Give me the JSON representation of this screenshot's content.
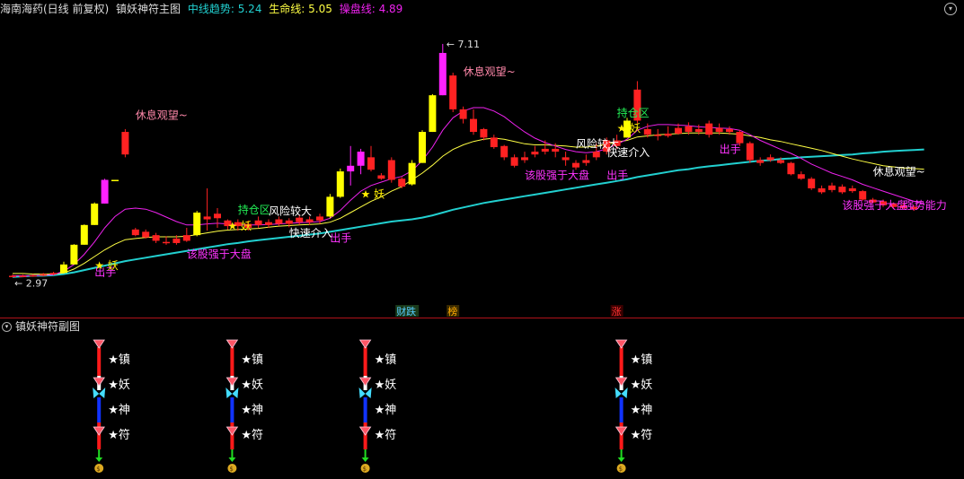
{
  "header": {
    "stock": "海南海药(日线 前复权)",
    "indicator": "镇妖神符主图",
    "mid_trend_label": "中线趋势:",
    "mid_trend_value": "5.24",
    "life_line_label": "生命线:",
    "life_line_value": "5.05",
    "operate_line_label": "操盘线:",
    "operate_line_value": "4.89"
  },
  "colors": {
    "up": "#ff2222",
    "down": "#ff2222",
    "strong_yellow": "#ffff00",
    "strong_magenta": "#ff22ff",
    "mid_trend": "#22d0d0",
    "life_line": "#ffff44",
    "operate_line": "#ee22ee",
    "bg": "#000000",
    "divider": "#b0121a"
  },
  "chart_data": {
    "type": "candlestick",
    "price_max_label": "7.11",
    "price_min_label": "2.97",
    "candles": [
      {
        "o": 2.98,
        "c": 3.0,
        "h": 3.02,
        "l": 2.97,
        "k": "r"
      },
      {
        "o": 3.0,
        "c": 3.0,
        "h": 3.02,
        "l": 2.98,
        "k": "r"
      },
      {
        "o": 2.99,
        "c": 3.01,
        "h": 3.03,
        "l": 2.98,
        "k": "r"
      },
      {
        "o": 3.0,
        "c": 3.03,
        "h": 3.05,
        "l": 2.99,
        "k": "r"
      },
      {
        "o": 3.03,
        "c": 3.05,
        "h": 3.07,
        "l": 3.01,
        "k": "r"
      },
      {
        "o": 3.05,
        "c": 3.2,
        "h": 3.25,
        "l": 3.04,
        "k": "y"
      },
      {
        "o": 3.2,
        "c": 3.55,
        "h": 3.56,
        "l": 3.2,
        "k": "y"
      },
      {
        "o": 3.55,
        "c": 3.9,
        "h": 3.91,
        "l": 3.55,
        "k": "y"
      },
      {
        "o": 3.9,
        "c": 4.28,
        "h": 4.3,
        "l": 3.9,
        "k": "y"
      },
      {
        "o": 4.28,
        "c": 4.7,
        "h": 4.72,
        "l": 4.28,
        "k": "m"
      },
      {
        "o": 4.7,
        "c": 4.7,
        "h": 4.7,
        "l": 4.7,
        "k": "y"
      },
      {
        "o": 5.15,
        "c": 5.55,
        "h": 5.6,
        "l": 5.1,
        "k": "r"
      },
      {
        "o": 3.82,
        "c": 3.72,
        "h": 3.85,
        "l": 3.7,
        "k": "r"
      },
      {
        "o": 3.68,
        "c": 3.78,
        "h": 3.82,
        "l": 3.66,
        "k": "r"
      },
      {
        "o": 3.72,
        "c": 3.62,
        "h": 3.76,
        "l": 3.58,
        "k": "r"
      },
      {
        "o": 3.6,
        "c": 3.6,
        "h": 3.7,
        "l": 3.55,
        "k": "r"
      },
      {
        "o": 3.58,
        "c": 3.66,
        "h": 3.72,
        "l": 3.55,
        "k": "r"
      },
      {
        "o": 3.62,
        "c": 3.72,
        "h": 3.85,
        "l": 3.6,
        "k": "r"
      },
      {
        "o": 3.72,
        "c": 4.12,
        "h": 4.15,
        "l": 3.7,
        "k": "y"
      },
      {
        "o": 4.0,
        "c": 4.05,
        "h": 4.55,
        "l": 3.8,
        "k": "r"
      },
      {
        "o": 4.1,
        "c": 4.02,
        "h": 4.2,
        "l": 3.85,
        "k": "r"
      },
      {
        "o": 3.98,
        "c": 3.88,
        "h": 4.0,
        "l": 3.82,
        "k": "r"
      },
      {
        "o": 3.88,
        "c": 3.95,
        "h": 4.0,
        "l": 3.8,
        "k": "r"
      },
      {
        "o": 3.92,
        "c": 3.85,
        "h": 3.98,
        "l": 3.8,
        "k": "r"
      },
      {
        "o": 3.9,
        "c": 3.98,
        "h": 4.05,
        "l": 3.85,
        "k": "r"
      },
      {
        "o": 3.95,
        "c": 3.9,
        "h": 4.0,
        "l": 3.85,
        "k": "r"
      },
      {
        "o": 3.92,
        "c": 4.0,
        "h": 4.05,
        "l": 3.88,
        "k": "r"
      },
      {
        "o": 3.98,
        "c": 3.92,
        "h": 4.02,
        "l": 3.86,
        "k": "r"
      },
      {
        "o": 3.95,
        "c": 4.03,
        "h": 4.08,
        "l": 3.9,
        "k": "r"
      },
      {
        "o": 4.0,
        "c": 3.95,
        "h": 4.05,
        "l": 3.9,
        "k": "r"
      },
      {
        "o": 3.98,
        "c": 4.05,
        "h": 4.1,
        "l": 3.92,
        "k": "r"
      },
      {
        "o": 4.05,
        "c": 4.4,
        "h": 4.45,
        "l": 4.02,
        "k": "y"
      },
      {
        "o": 4.4,
        "c": 4.85,
        "h": 4.9,
        "l": 4.38,
        "k": "y"
      },
      {
        "o": 4.85,
        "c": 4.95,
        "h": 5.3,
        "l": 4.6,
        "k": "m"
      },
      {
        "o": 4.95,
        "c": 5.2,
        "h": 5.25,
        "l": 4.8,
        "k": "m"
      },
      {
        "o": 5.1,
        "c": 4.88,
        "h": 5.3,
        "l": 4.85,
        "k": "r"
      },
      {
        "o": 4.78,
        "c": 4.72,
        "h": 4.82,
        "l": 4.7,
        "k": "r"
      },
      {
        "o": 5.05,
        "c": 4.7,
        "h": 5.1,
        "l": 4.65,
        "k": "r"
      },
      {
        "o": 4.72,
        "c": 4.58,
        "h": 4.75,
        "l": 4.55,
        "k": "r"
      },
      {
        "o": 4.62,
        "c": 5.0,
        "h": 5.05,
        "l": 4.6,
        "k": "y"
      },
      {
        "o": 5.0,
        "c": 5.55,
        "h": 5.58,
        "l": 5.0,
        "k": "y"
      },
      {
        "o": 5.55,
        "c": 6.2,
        "h": 6.22,
        "l": 5.55,
        "k": "y"
      },
      {
        "o": 6.2,
        "c": 6.95,
        "h": 7.11,
        "l": 6.2,
        "k": "m"
      },
      {
        "o": 6.55,
        "c": 5.95,
        "h": 6.6,
        "l": 5.9,
        "k": "r"
      },
      {
        "o": 5.95,
        "c": 5.78,
        "h": 6.0,
        "l": 5.7,
        "k": "r"
      },
      {
        "o": 5.78,
        "c": 5.55,
        "h": 5.95,
        "l": 5.5,
        "k": "r"
      },
      {
        "o": 5.6,
        "c": 5.45,
        "h": 5.62,
        "l": 5.4,
        "k": "r"
      },
      {
        "o": 5.45,
        "c": 5.28,
        "h": 5.5,
        "l": 5.25,
        "k": "r"
      },
      {
        "o": 5.3,
        "c": 5.1,
        "h": 5.32,
        "l": 5.05,
        "k": "r"
      },
      {
        "o": 5.1,
        "c": 4.95,
        "h": 5.15,
        "l": 4.92,
        "k": "r"
      },
      {
        "o": 5.05,
        "c": 5.1,
        "h": 5.2,
        "l": 5.0,
        "k": "r"
      },
      {
        "o": 5.15,
        "c": 5.2,
        "h": 5.3,
        "l": 5.1,
        "k": "r"
      },
      {
        "o": 5.25,
        "c": 5.2,
        "h": 5.4,
        "l": 5.15,
        "k": "r"
      },
      {
        "o": 5.2,
        "c": 5.25,
        "h": 5.35,
        "l": 5.1,
        "k": "r"
      },
      {
        "o": 5.1,
        "c": 5.05,
        "h": 5.2,
        "l": 4.95,
        "k": "r"
      },
      {
        "o": 5.0,
        "c": 4.92,
        "h": 5.05,
        "l": 4.88,
        "k": "r"
      },
      {
        "o": 5.0,
        "c": 5.05,
        "h": 5.15,
        "l": 4.95,
        "k": "r"
      },
      {
        "o": 5.1,
        "c": 5.2,
        "h": 5.35,
        "l": 5.05,
        "k": "r"
      },
      {
        "o": 5.2,
        "c": 5.4,
        "h": 5.45,
        "l": 5.15,
        "k": "r"
      },
      {
        "o": 5.4,
        "c": 5.3,
        "h": 5.5,
        "l": 5.25,
        "k": "r"
      },
      {
        "o": 5.45,
        "c": 5.75,
        "h": 5.8,
        "l": 5.45,
        "k": "y"
      },
      {
        "o": 6.3,
        "c": 5.75,
        "h": 6.45,
        "l": 5.7,
        "k": "r"
      },
      {
        "o": 5.6,
        "c": 5.5,
        "h": 5.7,
        "l": 5.45,
        "k": "r"
      },
      {
        "o": 5.5,
        "c": 5.48,
        "h": 5.6,
        "l": 5.4,
        "k": "r"
      },
      {
        "o": 5.48,
        "c": 5.52,
        "h": 5.65,
        "l": 5.45,
        "k": "r"
      },
      {
        "o": 5.52,
        "c": 5.62,
        "h": 5.7,
        "l": 5.5,
        "k": "r"
      },
      {
        "o": 5.65,
        "c": 5.55,
        "h": 5.72,
        "l": 5.5,
        "k": "r"
      },
      {
        "o": 5.55,
        "c": 5.6,
        "h": 5.68,
        "l": 5.5,
        "k": "r"
      },
      {
        "o": 5.7,
        "c": 5.5,
        "h": 5.75,
        "l": 5.45,
        "k": "r"
      },
      {
        "o": 5.55,
        "c": 5.62,
        "h": 5.7,
        "l": 5.5,
        "k": "r"
      },
      {
        "o": 5.6,
        "c": 5.55,
        "h": 5.65,
        "l": 5.5,
        "k": "r"
      },
      {
        "o": 5.55,
        "c": 5.35,
        "h": 5.58,
        "l": 5.3,
        "k": "r"
      },
      {
        "o": 5.35,
        "c": 5.05,
        "h": 5.38,
        "l": 5.0,
        "k": "r"
      },
      {
        "o": 5.05,
        "c": 5.0,
        "h": 5.1,
        "l": 4.95,
        "k": "r"
      },
      {
        "o": 5.1,
        "c": 5.05,
        "h": 5.15,
        "l": 5.02,
        "k": "r"
      },
      {
        "o": 5.05,
        "c": 5.0,
        "h": 5.1,
        "l": 4.98,
        "k": "r"
      },
      {
        "o": 5.0,
        "c": 4.8,
        "h": 5.02,
        "l": 4.78,
        "k": "r"
      },
      {
        "o": 4.8,
        "c": 4.72,
        "h": 4.85,
        "l": 4.7,
        "k": "r"
      },
      {
        "o": 4.72,
        "c": 4.55,
        "h": 4.75,
        "l": 4.52,
        "k": "r"
      },
      {
        "o": 4.55,
        "c": 4.48,
        "h": 4.6,
        "l": 4.45,
        "k": "r"
      },
      {
        "o": 4.6,
        "c": 4.52,
        "h": 4.65,
        "l": 4.48,
        "k": "r"
      },
      {
        "o": 4.58,
        "c": 4.48,
        "h": 4.62,
        "l": 4.45,
        "k": "r"
      },
      {
        "o": 4.55,
        "c": 4.5,
        "h": 4.6,
        "l": 4.47,
        "k": "r"
      },
      {
        "o": 4.5,
        "c": 4.35,
        "h": 4.52,
        "l": 4.33,
        "k": "r"
      },
      {
        "o": 4.35,
        "c": 4.3,
        "h": 4.38,
        "l": 4.28,
        "k": "r"
      },
      {
        "o": 4.32,
        "c": 4.25,
        "h": 4.35,
        "l": 4.22,
        "k": "r"
      },
      {
        "o": 4.28,
        "c": 4.22,
        "h": 4.3,
        "l": 4.2,
        "k": "r"
      },
      {
        "o": 4.25,
        "c": 4.2,
        "h": 4.3,
        "l": 4.18,
        "k": "r"
      },
      {
        "o": 4.22,
        "c": 4.18,
        "h": 4.25,
        "l": 4.15,
        "k": "r"
      }
    ],
    "mid_trend": [
      2.98,
      2.99,
      3.0,
      3.0,
      3.01,
      3.03,
      3.06,
      3.1,
      3.14,
      3.18,
      3.22,
      3.26,
      3.29,
      3.32,
      3.35,
      3.38,
      3.41,
      3.44,
      3.47,
      3.5,
      3.53,
      3.56,
      3.58,
      3.61,
      3.63,
      3.65,
      3.67,
      3.69,
      3.71,
      3.73,
      3.75,
      3.78,
      3.81,
      3.84,
      3.87,
      3.9,
      3.93,
      3.96,
      3.98,
      4.0,
      4.03,
      4.07,
      4.12,
      4.17,
      4.21,
      4.25,
      4.29,
      4.32,
      4.35,
      4.38,
      4.41,
      4.44,
      4.47,
      4.5,
      4.53,
      4.56,
      4.59,
      4.62,
      4.65,
      4.68,
      4.71,
      4.75,
      4.78,
      4.81,
      4.84,
      4.87,
      4.89,
      4.92,
      4.94,
      4.96,
      4.98,
      5.0,
      5.02,
      5.04,
      5.05,
      5.07,
      5.08,
      5.1,
      5.11,
      5.12,
      5.13,
      5.14,
      5.15,
      5.17,
      5.18,
      5.2,
      5.21,
      5.22,
      5.23,
      5.24
    ],
    "life_line": [
      3.04,
      3.04,
      3.03,
      3.03,
      3.03,
      3.05,
      3.12,
      3.22,
      3.34,
      3.46,
      3.56,
      3.64,
      3.66,
      3.68,
      3.69,
      3.69,
      3.69,
      3.7,
      3.73,
      3.76,
      3.79,
      3.81,
      3.82,
      3.83,
      3.84,
      3.86,
      3.88,
      3.89,
      3.9,
      3.91,
      3.92,
      3.95,
      4.02,
      4.12,
      4.22,
      4.32,
      4.4,
      4.5,
      4.58,
      4.7,
      4.82,
      4.96,
      5.12,
      5.24,
      5.32,
      5.38,
      5.42,
      5.44,
      5.42,
      5.38,
      5.34,
      5.32,
      5.32,
      5.31,
      5.3,
      5.28,
      5.28,
      5.3,
      5.33,
      5.37,
      5.4,
      5.46,
      5.48,
      5.5,
      5.51,
      5.52,
      5.53,
      5.53,
      5.53,
      5.53,
      5.52,
      5.51,
      5.48,
      5.45,
      5.41,
      5.38,
      5.34,
      5.3,
      5.26,
      5.22,
      5.17,
      5.12,
      5.07,
      5.03,
      4.99,
      4.95,
      4.93,
      4.91,
      4.9,
      4.89
    ],
    "operate_line": [
      3.0,
      3.0,
      3.0,
      3.01,
      3.02,
      3.08,
      3.2,
      3.38,
      3.6,
      3.85,
      4.05,
      4.18,
      4.2,
      4.18,
      4.12,
      4.04,
      3.96,
      3.9,
      3.9,
      3.92,
      3.93,
      3.92,
      3.9,
      3.9,
      3.9,
      3.91,
      3.92,
      3.93,
      3.94,
      3.95,
      3.96,
      4.02,
      4.16,
      4.34,
      4.5,
      4.6,
      4.66,
      4.72,
      4.76,
      4.86,
      5.04,
      5.28,
      5.58,
      5.8,
      5.92,
      5.98,
      5.98,
      5.92,
      5.82,
      5.68,
      5.55,
      5.44,
      5.36,
      5.3,
      5.24,
      5.2,
      5.18,
      5.2,
      5.25,
      5.33,
      5.42,
      5.58,
      5.65,
      5.68,
      5.68,
      5.67,
      5.66,
      5.64,
      5.63,
      5.62,
      5.61,
      5.58,
      5.5,
      5.4,
      5.32,
      5.24,
      5.17,
      5.08,
      4.98,
      4.9,
      4.82,
      4.76,
      4.7,
      4.62,
      4.56,
      4.5,
      4.44,
      4.38,
      4.32,
      4.28
    ]
  },
  "annotations": [
    {
      "text": "休息观望~",
      "i": 12,
      "p": 5.78,
      "color": "#ff88aa"
    },
    {
      "text": "休息观望~",
      "i": 44,
      "p": 6.55,
      "color": "#ff88aa"
    },
    {
      "text": "休息观望~",
      "i": 84,
      "p": 4.78,
      "color": "#ffffff"
    },
    {
      "text": "风险较大",
      "i": 25,
      "p": 4.08,
      "color": "#ffffff"
    },
    {
      "text": "持仓区",
      "i": 22,
      "p": 4.1,
      "color": "#22ee55"
    },
    {
      "text": "风险较大",
      "i": 55,
      "p": 5.27,
      "color": "#ffffff"
    },
    {
      "text": "持仓区",
      "i": 59,
      "p": 5.82,
      "color": "#22ee55"
    },
    {
      "text": "快速介入",
      "i": 27,
      "p": 3.69,
      "color": "#ffffff"
    },
    {
      "text": "快速介入",
      "i": 58,
      "p": 5.12,
      "color": "#ffffff"
    },
    {
      "text": "出手",
      "i": 31,
      "p": 3.6,
      "color": "#ff33ff"
    },
    {
      "text": "出手",
      "i": 58,
      "p": 4.72,
      "color": "#ff33ff"
    },
    {
      "text": "出手",
      "i": 69,
      "p": 5.18,
      "color": "#ff33ff"
    },
    {
      "text": "出手",
      "i": 8,
      "p": 3.0,
      "color": "#ff33ff"
    },
    {
      "text": "该股强于大盘",
      "i": 17,
      "p": 3.32,
      "color": "#ff33ff"
    },
    {
      "text": "该股强于大盘",
      "i": 50,
      "p": 4.72,
      "color": "#ff33ff"
    },
    {
      "text": "该股强于大盘",
      "i": 81,
      "p": 4.18,
      "color": "#ff33ff"
    },
    {
      "text": "强势能力",
      "i": 87,
      "p": 4.18,
      "color": "#ff33ff"
    },
    {
      "text": "★ 妖",
      "i": 8,
      "p": 3.12,
      "color": "#ffee00"
    },
    {
      "text": "★ 妖",
      "i": 21,
      "p": 3.82,
      "color": "#ffee00"
    },
    {
      "text": "★ 妖",
      "i": 34,
      "p": 4.38,
      "color": "#ffee00"
    },
    {
      "text": "★ 妖",
      "i": 59,
      "p": 5.55,
      "color": "#ffee00"
    }
  ],
  "event_badges": [
    {
      "text": "财跌",
      "i": 38,
      "color": "#55ccff",
      "bg": "#1a3a1a"
    },
    {
      "text": "榜",
      "i": 43,
      "color": "#ffaa00",
      "bg": "#3a2a00"
    },
    {
      "text": "涨",
      "i": 59,
      "color": "#ff3333",
      "bg": "#3a0000"
    }
  ],
  "sub": {
    "title": "镇妖神符副图",
    "signal_columns_i": [
      8,
      21,
      34,
      59
    ],
    "labels": [
      "★镇",
      "★妖",
      "★神",
      "★符"
    ]
  }
}
